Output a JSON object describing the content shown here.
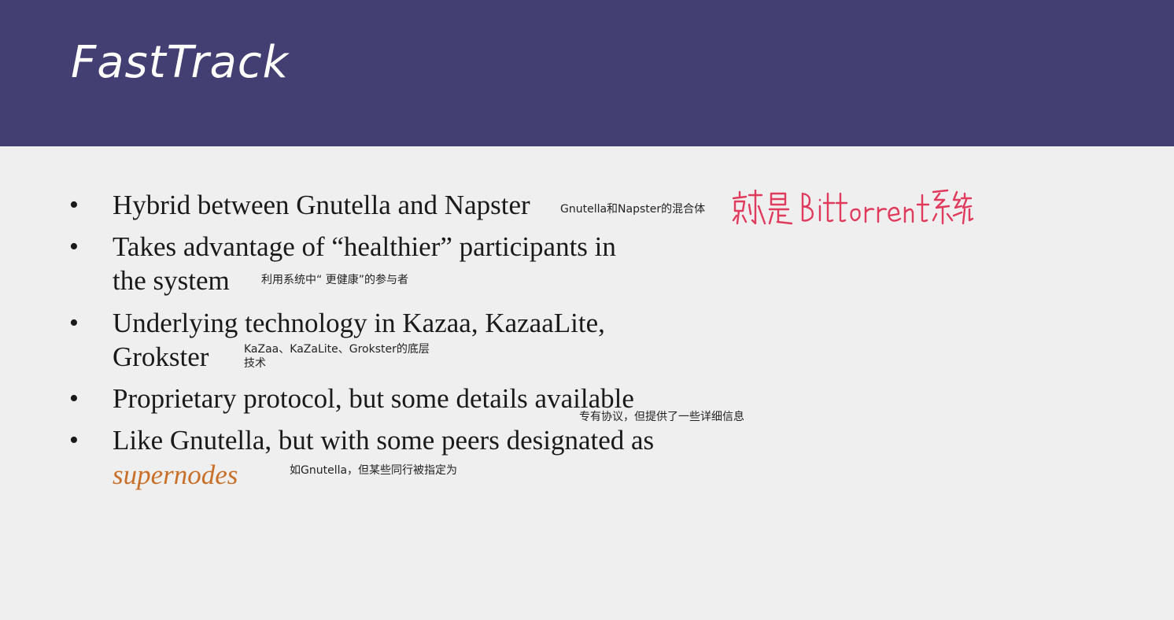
{
  "slide": {
    "title": "FastTrack",
    "bullets": [
      {
        "lines": [
          "Hybrid between Gnutella and Napster"
        ],
        "note": "Gnutella和Napster的混合体"
      },
      {
        "lines": [
          "Takes advantage of “healthier” participants in",
          "the system"
        ],
        "note": "利用系统中“ 更健康”的参与者"
      },
      {
        "lines": [
          "Underlying technology in Kazaa, KazaaLite,",
          "Grokster"
        ],
        "note_lines": [
          "KaZaa、KaZaLite、Grokster的底层",
          "技术"
        ]
      },
      {
        "lines": [
          "Proprietary protocol, but some details available"
        ],
        "note": "专有协议，但提供了一些详细信息"
      },
      {
        "lines": [
          "Like Gnutella, but with some peers designated as"
        ],
        "highlight": "supernodes",
        "note": "如Gnutella，但某些同行被指定为"
      }
    ],
    "handwritten_note": "就是 Bittorrent 系统",
    "colors": {
      "header_bg": "#433f73",
      "body_bg": "#efefef",
      "highlight": "#c8702a",
      "handwriting": "#e03a5c"
    }
  }
}
